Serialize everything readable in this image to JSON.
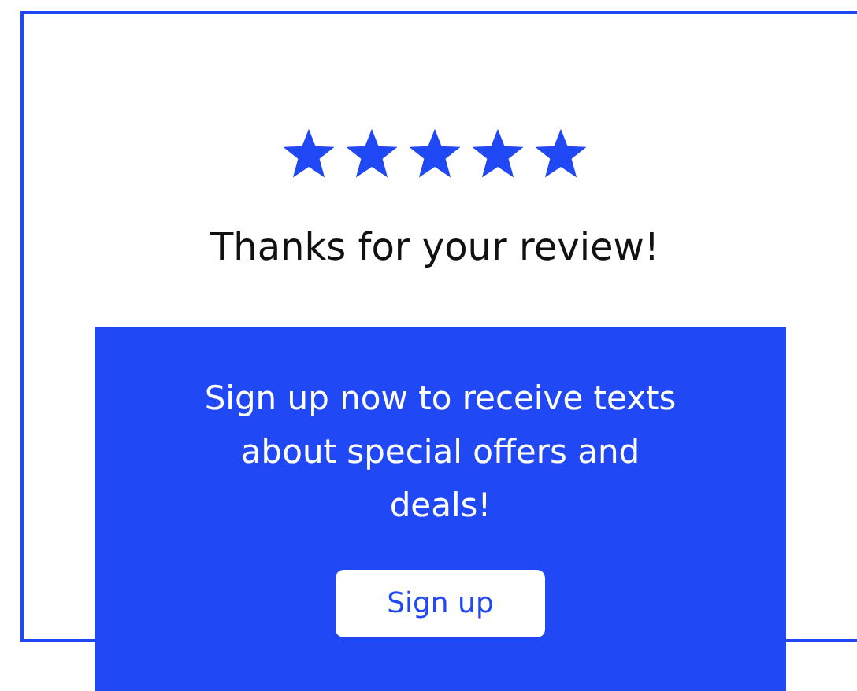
{
  "rating": {
    "stars": 5
  },
  "title": "Thanks for your review!",
  "promo": {
    "message": "Sign up now to receive texts about special offers and deals!",
    "button": "Sign up"
  }
}
